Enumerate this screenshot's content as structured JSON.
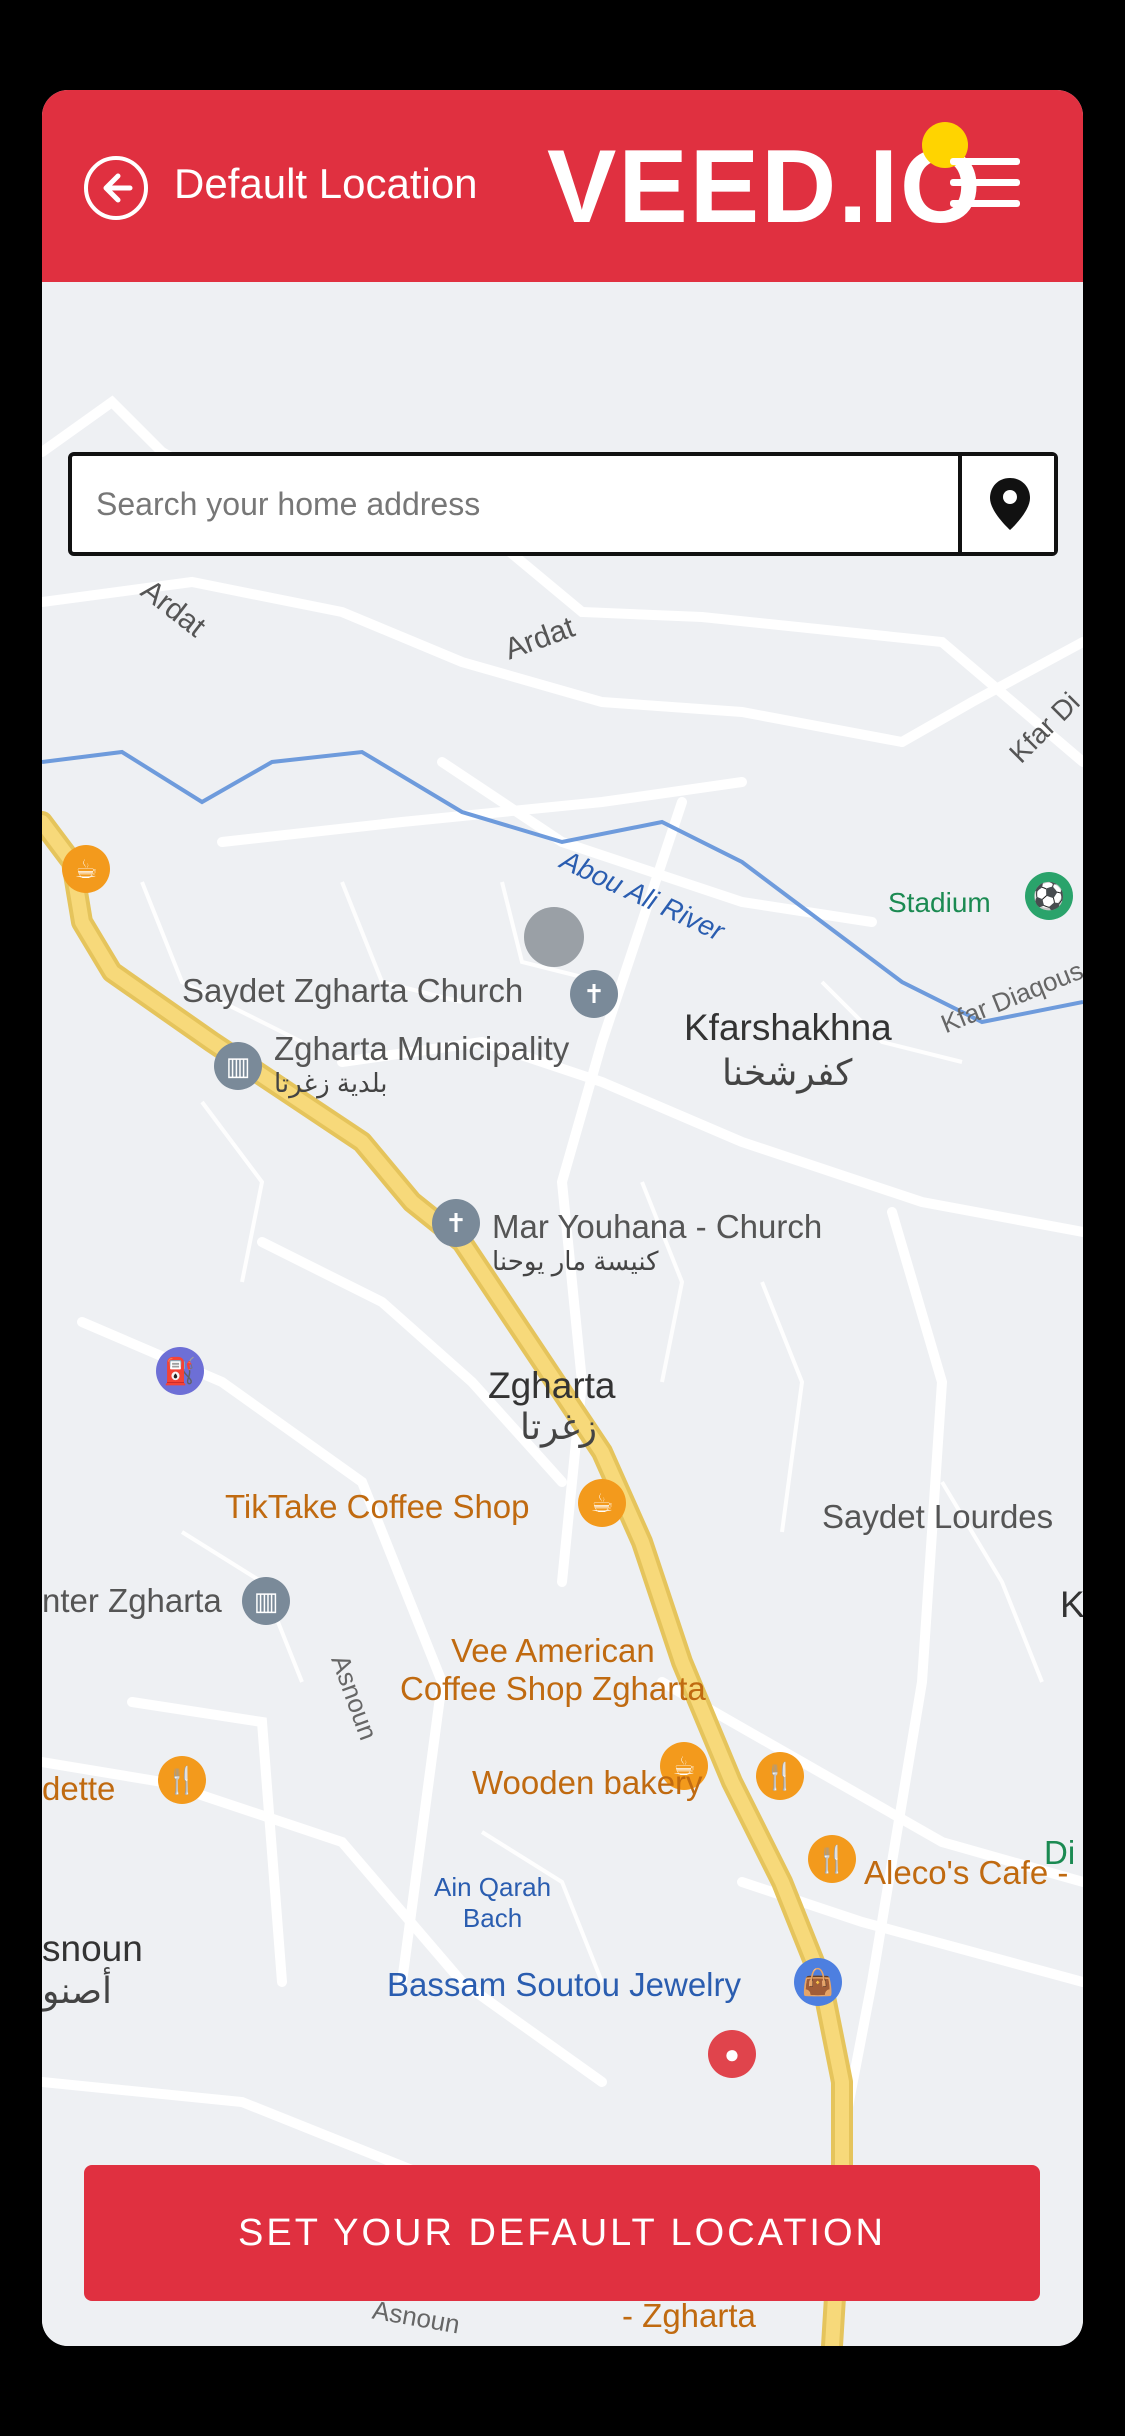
{
  "header": {
    "title": "Default Location",
    "logo": "VEED.IO"
  },
  "search": {
    "placeholder": "Search your home address",
    "value": ""
  },
  "map": {
    "labels": {
      "ardat_1": "Ardat",
      "ardat_2": "Ardat",
      "kfar": "Kfar Di",
      "river": "Abou Ali River",
      "stadium": "Stadium",
      "kfar_diaqous": "Kfar Diaqous",
      "saydet_church": "Saydet Zgharta Church",
      "kfarshakhna": "Kfarshakhna",
      "kfarshakhna_ar": "كفرشخنا",
      "municipality": "Zgharta Municipality",
      "municipality_ar": "بلدية زغرتا",
      "mar_youhana": "Mar Youhana - Church",
      "mar_youhana_ar": "كنيسة مار يوحنا",
      "zgharta": "Zgharta",
      "zgharta_ar": "زغرتا",
      "tiktake": "TikTake Coffee Shop",
      "saydet_lourdes": "Saydet Lourdes",
      "k": "K",
      "center_zgharta": "nter Zgharta",
      "vee_american": "Vee American\nCoffee Shop Zgharta",
      "asnoun": "Asnoun",
      "dette": "dette",
      "wooden_bakery": "Wooden bakery",
      "di": "Di",
      "aleco": "Aleco's Cafe -",
      "ain_qarah": "Ain Qarah\nBach",
      "snoun": "snoun",
      "snoun_ar": "أصنو",
      "bassam": "Bassam Soutou Jewelry",
      "zgharta_bottom": "- Zgharta",
      "asnoun_bottom": "Asnoun"
    }
  },
  "cta": {
    "label": "SET YOUR DEFAULT LOCATION"
  }
}
